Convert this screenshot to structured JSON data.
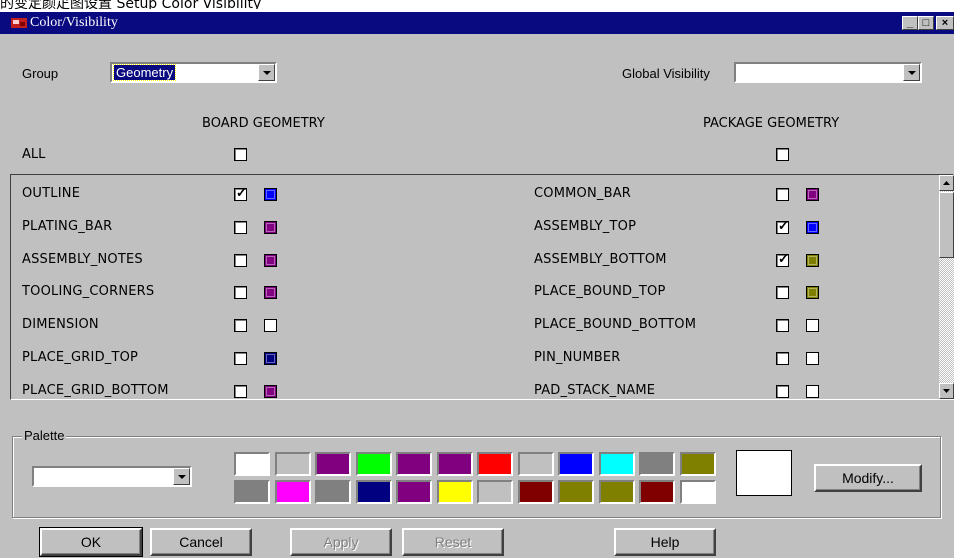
{
  "header_text": "的变定颜疋图设置 Setup Color Visibility",
  "window": {
    "title": "Color/Visibility",
    "minimize": "_",
    "maximize": "□",
    "close": "×"
  },
  "group": {
    "label": "Group",
    "value": "Geometry"
  },
  "global_visibility": {
    "label": "Global Visibility",
    "value": ""
  },
  "columns": {
    "board": "BOARD GEOMETRY",
    "package": "PACKAGE GEOMETRY",
    "all": "ALL"
  },
  "board_rows": [
    {
      "label": "OUTLINE",
      "checked": true,
      "color": "#0000ff"
    },
    {
      "label": "PLATING_BAR",
      "checked": false,
      "color": "#800080"
    },
    {
      "label": "ASSEMBLY_NOTES",
      "checked": false,
      "color": "#800080"
    },
    {
      "label": "TOOLING_CORNERS",
      "checked": false,
      "color": "#800080"
    },
    {
      "label": "DIMENSION",
      "checked": false,
      "color": "#ffffff"
    },
    {
      "label": "PLACE_GRID_TOP",
      "checked": false,
      "color": "#000080"
    },
    {
      "label": "PLACE_GRID_BOTTOM",
      "checked": false,
      "color": "#800080"
    }
  ],
  "package_rows": [
    {
      "label": "COMMON_BAR",
      "checked": false,
      "color": "#800080"
    },
    {
      "label": "ASSEMBLY_TOP",
      "checked": true,
      "color": "#0000ff"
    },
    {
      "label": "ASSEMBLY_BOTTOM",
      "checked": true,
      "color": "#808000"
    },
    {
      "label": "PLACE_BOUND_TOP",
      "checked": false,
      "color": "#808000"
    },
    {
      "label": "PLACE_BOUND_BOTTOM",
      "checked": false,
      "color": "#ffffff"
    },
    {
      "label": "PIN_NUMBER",
      "checked": false,
      "color": "#ffffff"
    },
    {
      "label": "PAD_STACK_NAME",
      "checked": false,
      "color": "#ffffff"
    }
  ],
  "palette": {
    "label": "Palette",
    "value": "",
    "row1": [
      "#ffffff",
      "#c0c0c0",
      "#800080",
      "#00ff00",
      "#800080",
      "#800080",
      "#ff0000",
      "#c0c0c0",
      "#0000ff",
      "#00ffff",
      "#808080",
      "#808000"
    ],
    "row2": [
      "#808080",
      "#ff00ff",
      "#808080",
      "#000080",
      "#800080",
      "#ffff00",
      "#c0c0c0",
      "#800000",
      "#808000",
      "#808000",
      "#800000",
      "#ffffff"
    ],
    "preview_color": "#ffffff",
    "modify_label": "Modify..."
  },
  "buttons": {
    "ok": "OK",
    "cancel": "Cancel",
    "apply": "Apply",
    "reset": "Reset",
    "help": "Help"
  }
}
